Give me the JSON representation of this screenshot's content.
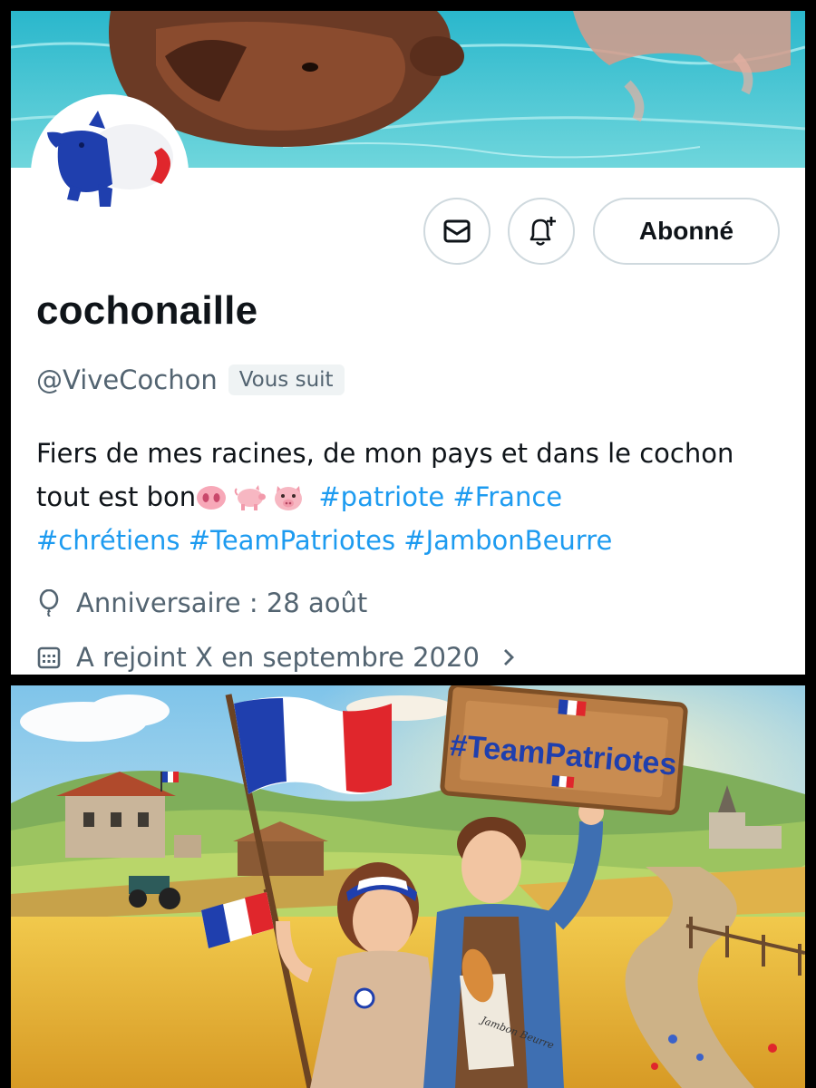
{
  "profile": {
    "display_name": "cochonaille",
    "handle": "@ViveCochon",
    "follows_you_badge": "Vous suit",
    "bio_text": "Fiers de mes racines, de mon pays et dans le cochon tout est bon",
    "bio_emojis": [
      "pig-nose-emoji",
      "pig-emoji",
      "pig-face-emoji"
    ],
    "hashtags": [
      "#patriote",
      "#France",
      "#chrétiens",
      "#TeamPatriotes",
      "#JambonBeurre"
    ],
    "birthday": "Anniversaire : 28 août",
    "joined": "A rejoint X en septembre 2020"
  },
  "actions": {
    "message_icon": "envelope-icon",
    "notify_icon": "bell-plus-icon",
    "follow_label": "Abonné"
  },
  "illustration": {
    "sign_text": "#TeamPatriotes",
    "bag_text": "Jambon Beurre"
  },
  "colors": {
    "link": "#1d9bf0",
    "secondary_text": "#536471",
    "primary_text": "#0f1419",
    "border": "#cfd9de",
    "flag_blue": "#1f3fae",
    "flag_red": "#e0262c"
  }
}
